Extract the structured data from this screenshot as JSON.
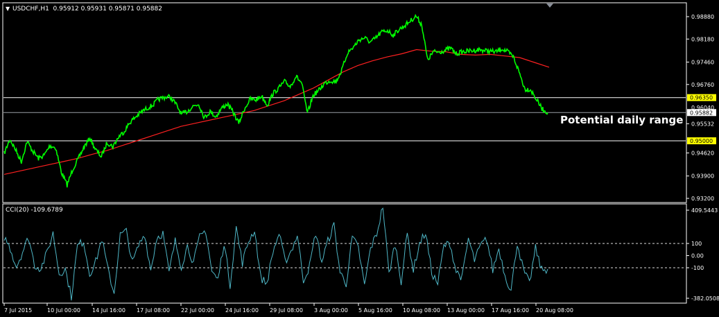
{
  "window": {
    "symbol_header": "USDCHF,H1  0.95912 0.95931 0.95871 0.95882",
    "indicator_header": "CCI(20) -109.6789"
  },
  "colors": {
    "background": "#000000",
    "frame": "#ffffff",
    "price_line": "#00ff00",
    "moving_average": "#ff2020",
    "cci_line": "#4fb8c8",
    "level_line": "#ffffff",
    "highlight_label_bg": "#ffff00"
  },
  "annotation": {
    "text": "Potential daily range"
  },
  "chart_data": [
    {
      "type": "line",
      "title": "USDCHF,H1  0.95912 0.95931 0.95871 0.95882",
      "ylim": [
        0.932,
        0.991
      ],
      "y_ticks": [
        "0.98880",
        "0.98180",
        "0.97460",
        "0.96760",
        "0.95532",
        "0.94620",
        "0.93900",
        "0.93200"
      ],
      "y_tick_values": [
        0.9888,
        0.9818,
        0.9746,
        0.9676,
        0.95532,
        0.9462,
        0.939,
        0.932
      ],
      "highlighted_levels": [
        {
          "label": "0.96350",
          "value": 0.9635
        },
        {
          "label": "0.95000",
          "value": 0.95
        }
      ],
      "current_price": {
        "label": "0.95882",
        "value": 0.95882
      },
      "hidden_tick": {
        "label": "0.96040",
        "value": 0.9604
      },
      "x_ticks": [
        "7 Jul 2015",
        "10 Jul 00:00",
        "14 Jul 16:00",
        "17 Jul 08:00",
        "22 Jul 00:00",
        "24 Jul 16:00",
        "29 Jul 08:00",
        "3 Aug 00:00",
        "5 Aug 16:00",
        "10 Aug 08:00",
        "13 Aug 00:00",
        "17 Aug 16:00",
        "20 Aug 08:00"
      ],
      "series": [
        {
          "values": [
            0.946,
            0.9505,
            0.9472,
            0.9435,
            0.9498,
            0.9468,
            0.9445,
            0.9455,
            0.9485,
            0.9478,
            0.9402,
            0.9362,
            0.9412,
            0.9445,
            0.9482,
            0.9508,
            0.9472,
            0.945,
            0.9495,
            0.9482,
            0.9512,
            0.953,
            0.9558,
            0.9575,
            0.959,
            0.9602,
            0.9612,
            0.963,
            0.9636,
            0.9638,
            0.9615,
            0.9583,
            0.9592,
            0.9608,
            0.9615,
            0.9572,
            0.9592,
            0.9575,
            0.9602,
            0.9615,
            0.959,
            0.9555,
            0.96,
            0.963,
            0.9628,
            0.964,
            0.9612,
            0.9648,
            0.9665,
            0.9685,
            0.967,
            0.9702,
            0.968,
            0.9585,
            0.9642,
            0.9658,
            0.968,
            0.9688,
            0.9685,
            0.972,
            0.9775,
            0.9792,
            0.9815,
            0.9822,
            0.9808,
            0.9822,
            0.984,
            0.9845,
            0.983,
            0.9848,
            0.986,
            0.9875,
            0.989,
            0.9862,
            0.9752,
            0.9778,
            0.9778,
            0.9782,
            0.979,
            0.9772,
            0.9778,
            0.978,
            0.9782,
            0.9785,
            0.9782,
            0.978,
            0.9778,
            0.9788,
            0.9778,
            0.9762,
            0.9715,
            0.9662,
            0.966,
            0.963,
            0.96,
            0.95882
          ]
        },
        {
          "values": [
            0.9395,
            0.9405,
            0.9415,
            0.9425,
            0.9435,
            0.9445,
            0.9458,
            0.947,
            0.9485,
            0.95,
            0.9515,
            0.953,
            0.9545,
            0.9555,
            0.9565,
            0.9575,
            0.9585,
            0.9595,
            0.961,
            0.9625,
            0.9645,
            0.9665,
            0.969,
            0.9715,
            0.9735,
            0.975,
            0.9762,
            0.9772,
            0.9785,
            0.978,
            0.9778,
            0.977,
            0.9768,
            0.977,
            0.9765,
            0.976,
            0.9745,
            0.973
          ]
        },
        {
          "values": [
            155,
            60,
            -90,
            30,
            150,
            -80,
            -105,
            20,
            185,
            -150,
            -110,
            -340,
            80,
            120,
            -150,
            -50,
            140,
            -120,
            -310,
            170,
            200,
            -60,
            80,
            180,
            -120,
            150,
            185,
            -140,
            120,
            -90,
            80,
            -60,
            150,
            210,
            -130,
            -200,
            110,
            -240,
            230,
            -60,
            120,
            210,
            -180,
            -230,
            30,
            180,
            -50,
            40,
            170,
            -200,
            -90,
            190,
            -50,
            120,
            250,
            -140,
            -230,
            150,
            60,
            -250,
            60,
            180,
            410,
            -150,
            100,
            -210,
            180,
            -120,
            100,
            190,
            -140,
            -230,
            80,
            100,
            -130,
            -180,
            140,
            -40,
            80,
            140,
            -120,
            60,
            -160,
            -290,
            110,
            -120,
            -230,
            60,
            -120,
            -110
          ]
        }
      ],
      "sub_chart": {
        "type": "line",
        "title": "CCI(20) -109.6789",
        "ylim": [
          -382.0508,
          409.5443
        ],
        "y_ticks": [
          "409.5443",
          "100",
          "0.00",
          "-100",
          "-382.0508"
        ],
        "y_tick_values": [
          409.5443,
          100,
          0,
          -100,
          -382.0508
        ],
        "levels": [
          100,
          -100
        ]
      }
    }
  ]
}
